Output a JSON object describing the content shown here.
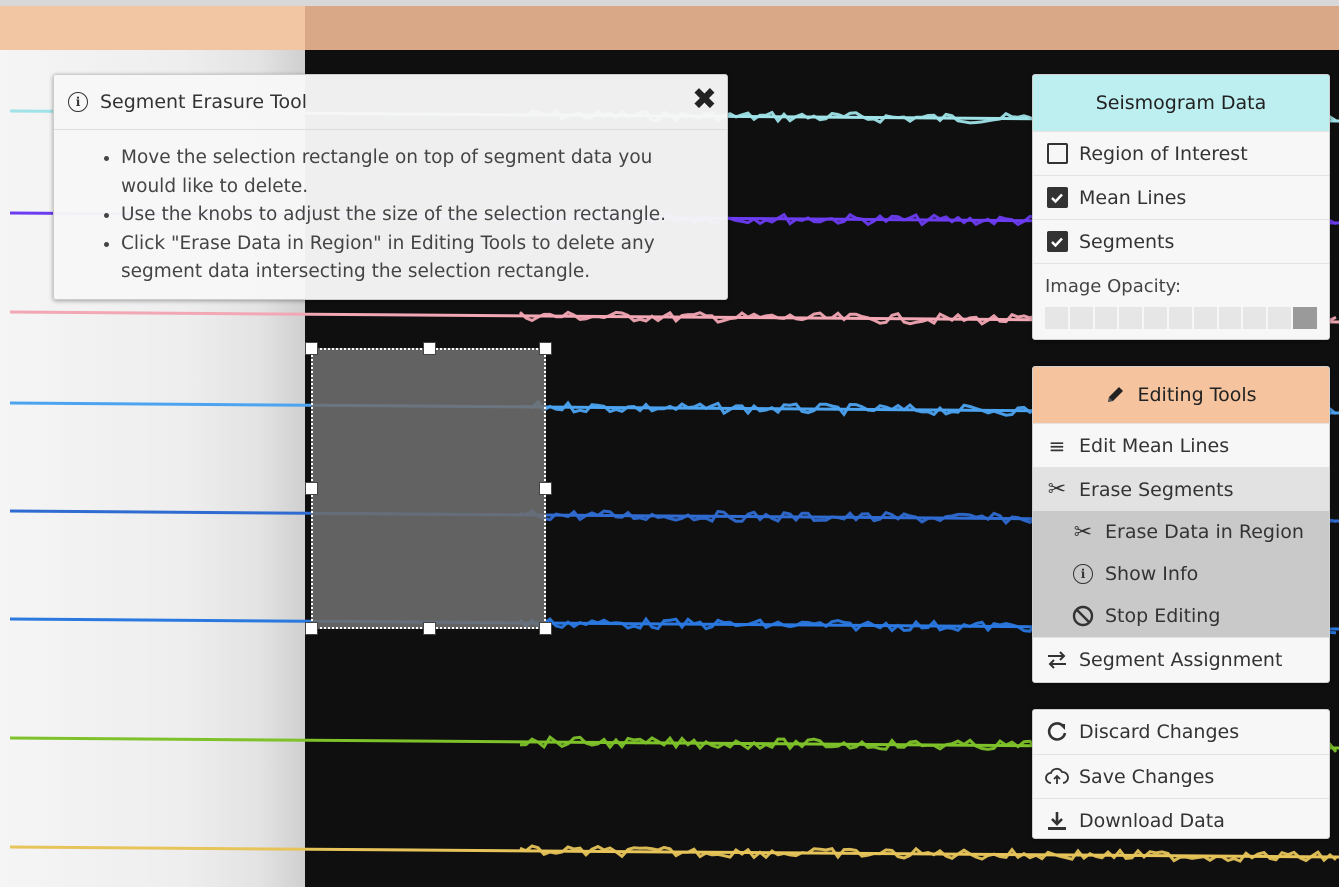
{
  "info_panel": {
    "icon": "info-circle-icon",
    "title": "Segment Erasure Tool",
    "close_icon": "close-icon",
    "bullets": [
      "Move the selection rectangle on top of segment data you would like to delete.",
      "Use the knobs to adjust the size of the selection rectangle.",
      "Click \"Erase Data in Region\" in Editing Tools to delete any segment data intersecting the selection rectangle."
    ]
  },
  "seismogram_panel": {
    "title": "Seismogram Data",
    "header_color": "#bdeef0",
    "items": [
      {
        "label": "Region of Interest",
        "checked": false
      },
      {
        "label": "Mean Lines",
        "checked": true
      },
      {
        "label": "Segments",
        "checked": true
      }
    ],
    "opacity_label": "Image Opacity:"
  },
  "editing_panel": {
    "title": "Editing Tools",
    "header_icon": "pencil-icon",
    "header_color": "#f5c49f",
    "edit_mean_lines": "Edit Mean Lines",
    "erase_segments": "Erase Segments",
    "sub_items": [
      {
        "label": "Erase Data in Region",
        "icon": "scissors-icon"
      },
      {
        "label": "Show Info",
        "icon": "info-circle-icon"
      },
      {
        "label": "Stop Editing",
        "icon": "ban-icon"
      }
    ],
    "segment_assignment": "Segment Assignment"
  },
  "actions_panel": {
    "discard": "Discard Changes",
    "save": "Save Changes",
    "download": "Download Data"
  },
  "trace_colors": [
    "#9fe3e8",
    "#6c3cf0",
    "#f2a7b4",
    "#4ca3f0",
    "#2f6bd1",
    "#2a78e0",
    "#7ec22a",
    "#e6c45a"
  ]
}
